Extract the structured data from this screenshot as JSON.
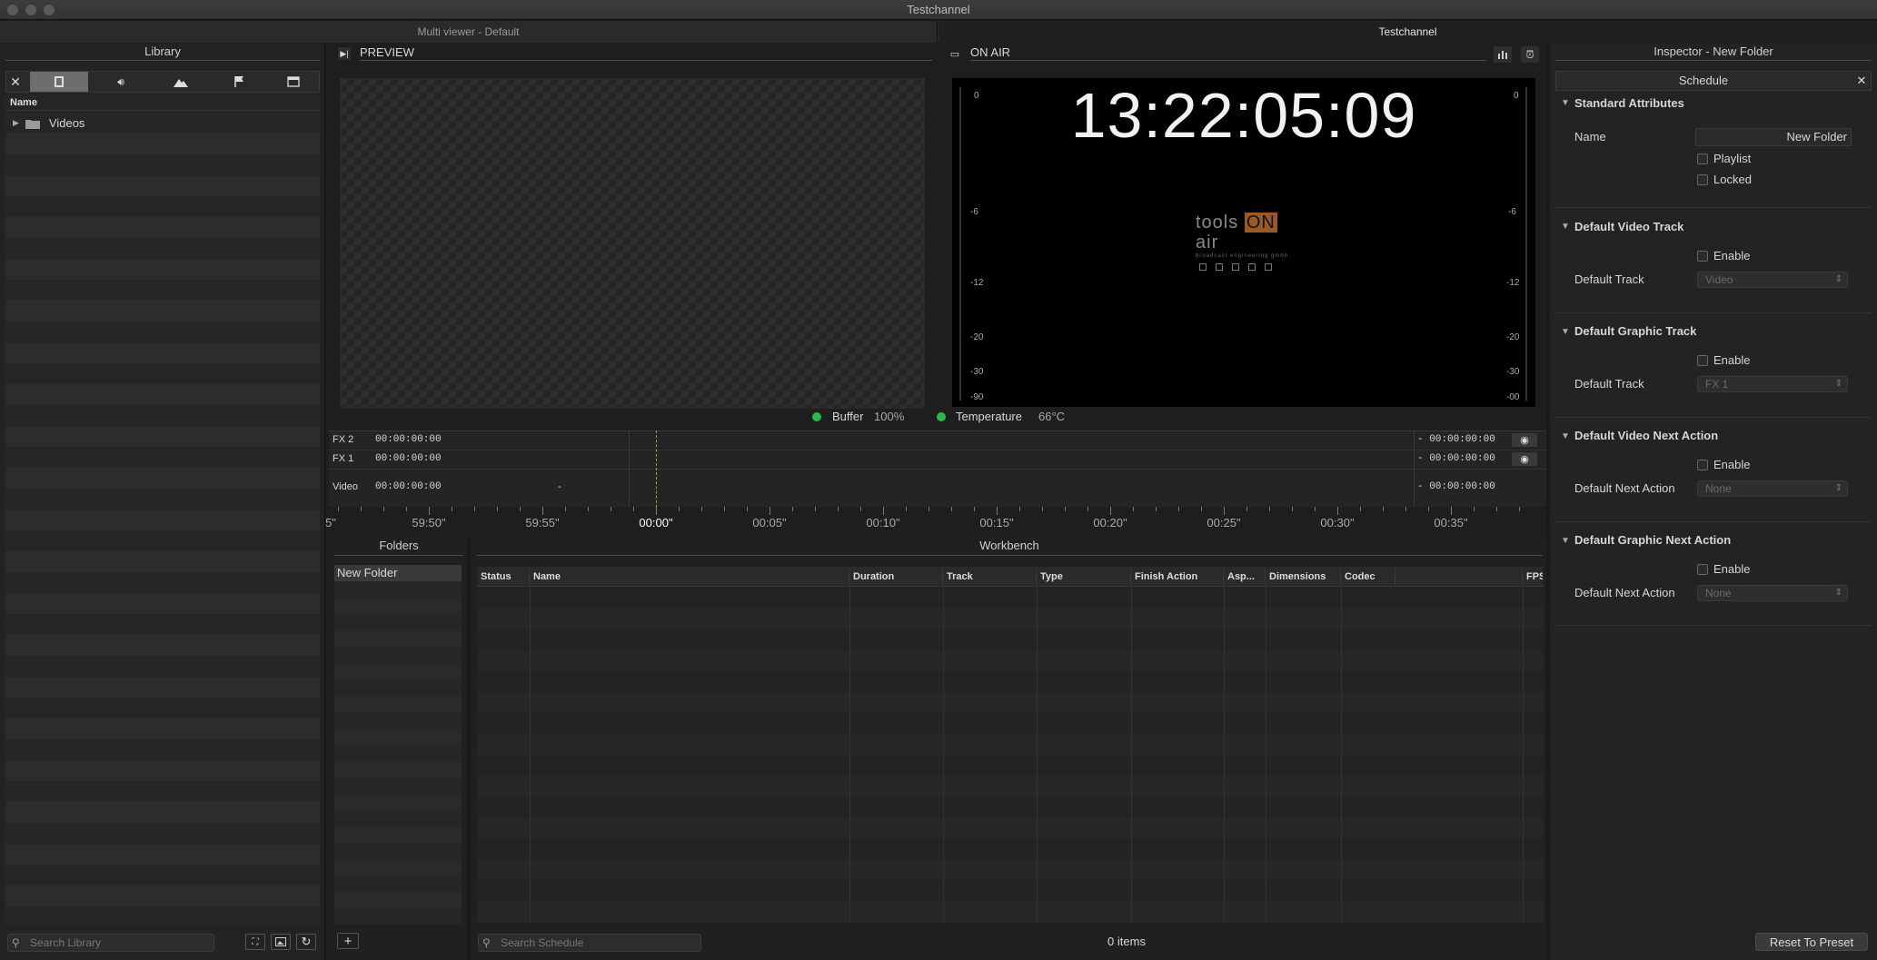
{
  "window": {
    "title": "Testchannel"
  },
  "tabs": [
    {
      "label": "Multi viewer - Default",
      "active": false
    },
    {
      "label": "Testchannel",
      "active": true
    }
  ],
  "library": {
    "title": "Library",
    "column_header": "Name",
    "items": [
      {
        "label": "Videos",
        "icon": "folder-icon"
      }
    ],
    "search_placeholder": "Search Library"
  },
  "preview": {
    "title": "PREVIEW"
  },
  "on_air": {
    "title": "ON AIR",
    "timecode": "13:22:05:09",
    "logo_text_left": "tools",
    "logo_text_mid": "ON",
    "logo_text_right": "air",
    "logo_tagline": "broadcast engineering gmbh",
    "meter_ticks": [
      "0",
      "-6",
      "-12",
      "-20",
      "-30",
      "-90"
    ],
    "meter_ticks_right": [
      "0",
      "-6",
      "-12",
      "-20",
      "-30",
      "-00"
    ]
  },
  "status": {
    "buffer_label": "Buffer",
    "buffer_value": "100%",
    "temperature_label": "Temperature",
    "temperature_value": "66°C",
    "ok_color": "#2fb84a"
  },
  "tracks": [
    {
      "name": "FX 2",
      "start": "00:00:00:00",
      "remaining": "- 00:00:00:00",
      "marker": ""
    },
    {
      "name": "FX 1",
      "start": "00:00:00:00",
      "remaining": "- 00:00:00:00",
      "marker": ""
    },
    {
      "name": "Video",
      "start": "00:00:00:00",
      "remaining": "- 00:00:00:00",
      "marker": "-"
    }
  ],
  "timeline": {
    "labels": [
      "5\"",
      "59:50\"",
      "59:55\"",
      "00:00\"",
      "00:05\"",
      "00:10\"",
      "00:15\"",
      "00:20\"",
      "00:25\"",
      "00:30\"",
      "00:35\""
    ],
    "playhead_label": "00:00\""
  },
  "folders": {
    "title": "Folders",
    "items": [
      "New Folder"
    ]
  },
  "workbench": {
    "title": "Workbench",
    "columns": [
      "Status",
      "Name",
      "Duration",
      "Track",
      "Type",
      "Finish Action",
      "Asp...",
      "Dimensions",
      "Codec",
      "",
      "FPS"
    ],
    "search_placeholder": "Search Schedule",
    "item_count": "0 items"
  },
  "inspector": {
    "title": "Inspector - New Folder",
    "tab": "Schedule",
    "sections": {
      "standard": {
        "title": "Standard Attributes",
        "name_label": "Name",
        "name_value": "New Folder",
        "playlist_label": "Playlist",
        "locked_label": "Locked"
      },
      "video_track": {
        "title": "Default Video Track",
        "enable_label": "Enable",
        "field_label": "Default Track",
        "field_value": "Video"
      },
      "graphic_track": {
        "title": "Default Graphic Track",
        "enable_label": "Enable",
        "field_label": "Default Track",
        "field_value": "FX 1"
      },
      "video_next": {
        "title": "Default Video Next Action",
        "enable_label": "Enable",
        "field_label": "Default Next Action",
        "field_value": "None"
      },
      "graphic_next": {
        "title": "Default Graphic Next Action",
        "enable_label": "Enable",
        "field_label": "Default Next Action",
        "field_value": "None"
      }
    },
    "reset_button": "Reset To Preset"
  }
}
